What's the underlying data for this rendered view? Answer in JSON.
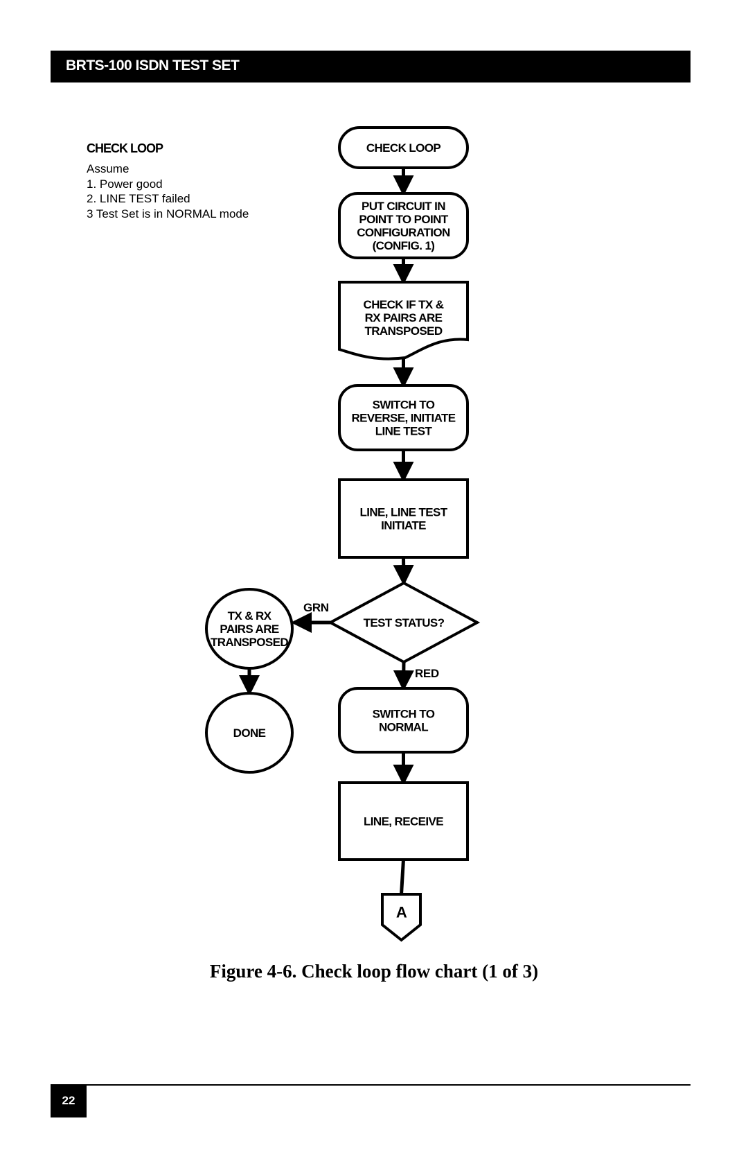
{
  "header": {
    "title": "BRTS-100 ISDN TEST SET"
  },
  "side_note": {
    "title": "CHECK LOOP",
    "lines": [
      "Assume",
      "1. Power good",
      "2. LINE TEST failed",
      "3 Test Set is in NORMAL mode"
    ]
  },
  "flowchart": {
    "nodes": [
      {
        "id": "check-loop",
        "shape": "terminal",
        "lines": [
          "CHECK LOOP"
        ]
      },
      {
        "id": "put-circuit",
        "shape": "rounded",
        "lines": [
          "PUT CIRCUIT IN",
          "POINT TO POINT",
          "CONFIGURATION",
          "(CONFIG. 1)"
        ]
      },
      {
        "id": "check-if-tx-rx",
        "shape": "document",
        "lines": [
          "CHECK IF TX &",
          "RX PAIRS ARE",
          "TRANSPOSED"
        ]
      },
      {
        "id": "switch-to-reverse",
        "shape": "rounded",
        "lines": [
          "SWITCH TO",
          "REVERSE, INITIATE",
          "LINE TEST"
        ]
      },
      {
        "id": "line-test-initiate",
        "shape": "rect",
        "lines": [
          "LINE, LINE TEST",
          "INITIATE"
        ]
      },
      {
        "id": "test-status",
        "shape": "diamond",
        "lines": [
          "TEST STATUS?"
        ]
      },
      {
        "id": "pairs-transposed",
        "shape": "circle",
        "lines": [
          "TX & RX",
          "PAIRS ARE",
          "TRANSPOSED"
        ]
      },
      {
        "id": "done",
        "shape": "circle",
        "lines": [
          "DONE"
        ]
      },
      {
        "id": "switch-to-normal",
        "shape": "rounded",
        "lines": [
          "SWITCH TO",
          "NORMAL"
        ]
      },
      {
        "id": "line-receive",
        "shape": "rect",
        "lines": [
          "LINE, RECEIVE"
        ]
      },
      {
        "id": "connector-a",
        "shape": "offpage",
        "lines": [
          "A"
        ]
      }
    ],
    "edges": [
      {
        "from": "check-loop",
        "to": "put-circuit",
        "label": ""
      },
      {
        "from": "put-circuit",
        "to": "check-if-tx-rx",
        "label": ""
      },
      {
        "from": "check-if-tx-rx",
        "to": "switch-to-reverse",
        "label": ""
      },
      {
        "from": "switch-to-reverse",
        "to": "line-test-initiate",
        "label": ""
      },
      {
        "from": "line-test-initiate",
        "to": "test-status",
        "label": ""
      },
      {
        "from": "test-status",
        "to": "pairs-transposed",
        "label": "GRN"
      },
      {
        "from": "pairs-transposed",
        "to": "done",
        "label": ""
      },
      {
        "from": "test-status",
        "to": "switch-to-normal",
        "label": "RED"
      },
      {
        "from": "switch-to-normal",
        "to": "line-receive",
        "label": ""
      },
      {
        "from": "line-receive",
        "to": "connector-a",
        "label": ""
      }
    ]
  },
  "caption": "Figure 4-6.  Check loop flow chart (1 of 3)",
  "footer": {
    "page_number": "22"
  }
}
